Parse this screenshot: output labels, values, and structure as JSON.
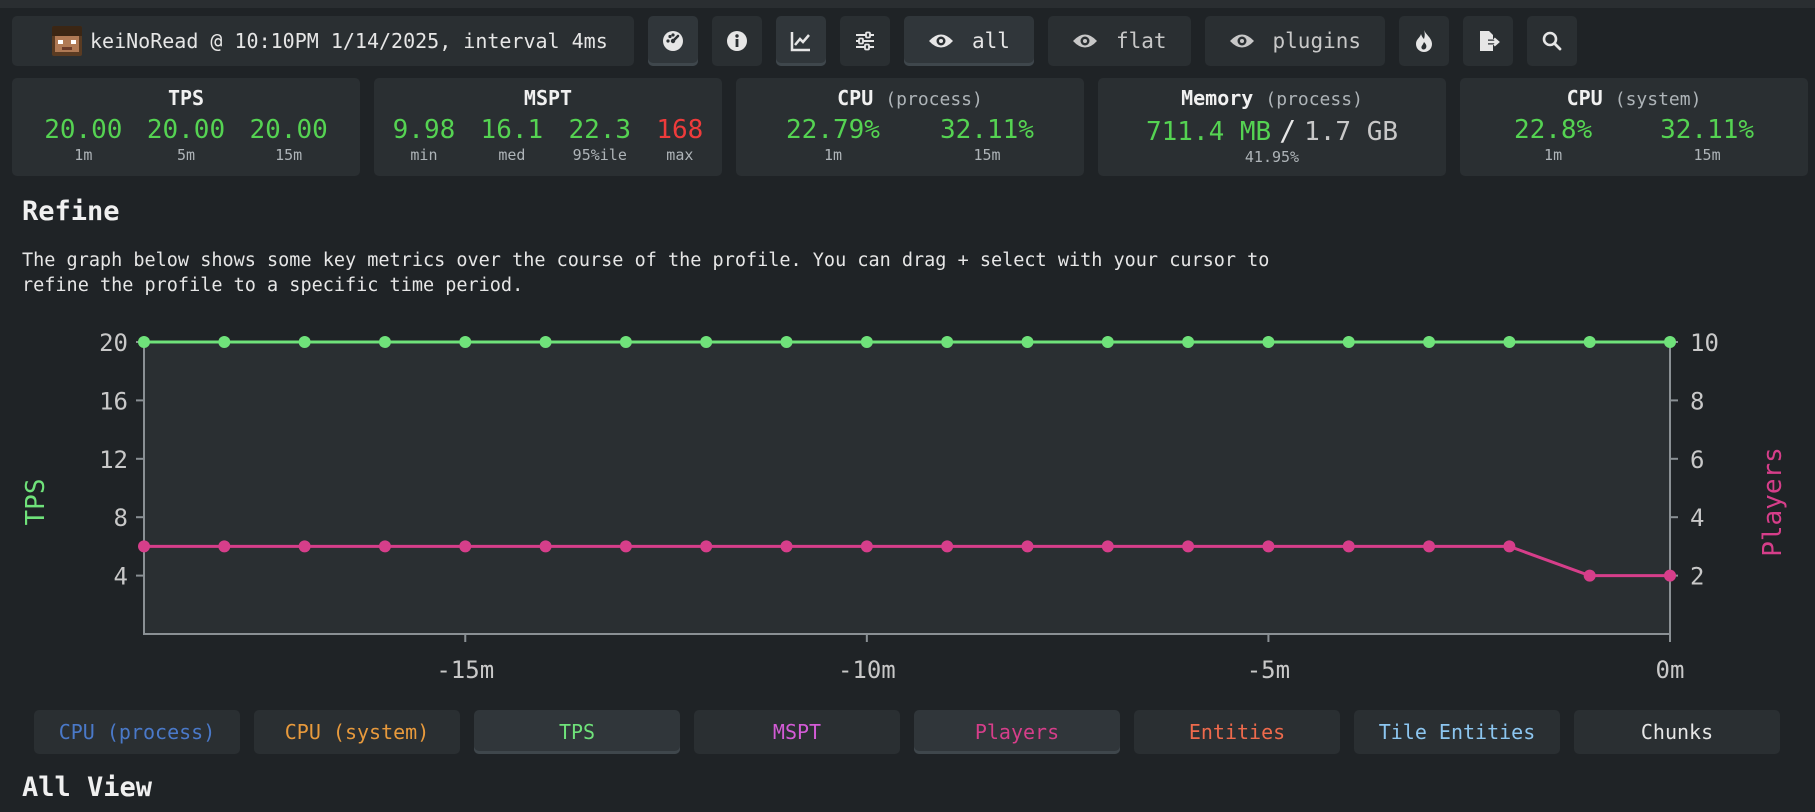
{
  "header": {
    "info_text": "keiNoRead @ 10:10PM 1/14/2025, interval 4ms",
    "icons": [
      "dashboard-icon",
      "info-icon",
      "chart-icon",
      "settings-icon",
      "flame-icon",
      "export-icon",
      "search-icon"
    ],
    "views": [
      {
        "label": "all",
        "active": true
      },
      {
        "label": "flat",
        "active": false
      },
      {
        "label": "plugins",
        "active": false
      }
    ]
  },
  "stats": {
    "tps": {
      "title": "TPS",
      "values": [
        {
          "v": "20.00",
          "l": "1m"
        },
        {
          "v": "20.00",
          "l": "5m"
        },
        {
          "v": "20.00",
          "l": "15m"
        }
      ]
    },
    "mspt": {
      "title": "MSPT",
      "values": [
        {
          "v": "9.98",
          "l": "min"
        },
        {
          "v": "16.1",
          "l": "med"
        },
        {
          "v": "22.3",
          "l": "95%ile"
        },
        {
          "v": "168",
          "l": "max"
        }
      ]
    },
    "cpu_process": {
      "title": "CPU",
      "sub": "(process)",
      "values": [
        {
          "v": "22.79%",
          "l": "1m"
        },
        {
          "v": "32.11%",
          "l": "15m"
        }
      ]
    },
    "memory": {
      "title": "Memory",
      "sub": "(process)",
      "used": "711.4 MB",
      "sep": "/",
      "total": "1.7 GB",
      "percent": "41.95%"
    },
    "cpu_system": {
      "title": "CPU",
      "sub": "(system)",
      "values": [
        {
          "v": "22.8%",
          "l": "1m"
        },
        {
          "v": "32.11%",
          "l": "15m"
        }
      ]
    }
  },
  "refine": {
    "title": "Refine",
    "description": "The graph below shows some key metrics over the course of the profile. You can drag + select with your cursor to refine the profile to a specific time period."
  },
  "all_view_title": "All View",
  "legend": [
    {
      "label": "CPU (process)",
      "color": "#4a79c9",
      "active": false
    },
    {
      "label": "CPU (system)",
      "color": "#e89a3c",
      "active": false
    },
    {
      "label": "TPS",
      "color": "#6fe27a",
      "active": true
    },
    {
      "label": "MSPT",
      "color": "#d35bd6",
      "active": false
    },
    {
      "label": "Players",
      "color": "#d63e8a",
      "active": true
    },
    {
      "label": "Entities",
      "color": "#ee6a4c",
      "active": false
    },
    {
      "label": "Tile Entities",
      "color": "#8cc6f0",
      "active": false
    },
    {
      "label": "Chunks",
      "color": "#e6e6e6",
      "active": false
    }
  ],
  "chart_data": {
    "type": "line",
    "ylabel_left": "TPS",
    "ylabel_right": "Players",
    "y_left_ticks": [
      "20",
      "16",
      "12",
      "8",
      "4"
    ],
    "y_left_range": [
      0,
      20
    ],
    "y_right_ticks": [
      "10",
      "8",
      "6",
      "4",
      "2"
    ],
    "y_right_range": [
      0,
      10
    ],
    "x_ticks": [
      "-15m",
      "-10m",
      "-5m",
      "0m"
    ],
    "x_range_minutes": [
      -19,
      0
    ],
    "grid": false,
    "series": [
      {
        "name": "TPS",
        "axis": "left",
        "color": "#6fe27a",
        "x": [
          -19,
          -18,
          -17,
          -16,
          -15,
          -14,
          -13,
          -12,
          -11,
          -10,
          -9,
          -8,
          -7,
          -6,
          -5,
          -4,
          -3,
          -2,
          -1,
          0
        ],
        "values": [
          20,
          20,
          20,
          20,
          20,
          20,
          20,
          20,
          20,
          20,
          20,
          20,
          20,
          20,
          20,
          20,
          20,
          20,
          20,
          20
        ]
      },
      {
        "name": "Players",
        "axis": "right",
        "color": "#d63e8a",
        "x": [
          -19,
          -18,
          -17,
          -16,
          -15,
          -14,
          -13,
          -12,
          -11,
          -10,
          -9,
          -8,
          -7,
          -6,
          -5,
          -4,
          -3,
          -2,
          -1,
          0
        ],
        "values": [
          3,
          3,
          3,
          3,
          3,
          3,
          3,
          3,
          3,
          3,
          3,
          3,
          3,
          3,
          3,
          3,
          3,
          3,
          2,
          2
        ]
      }
    ]
  }
}
